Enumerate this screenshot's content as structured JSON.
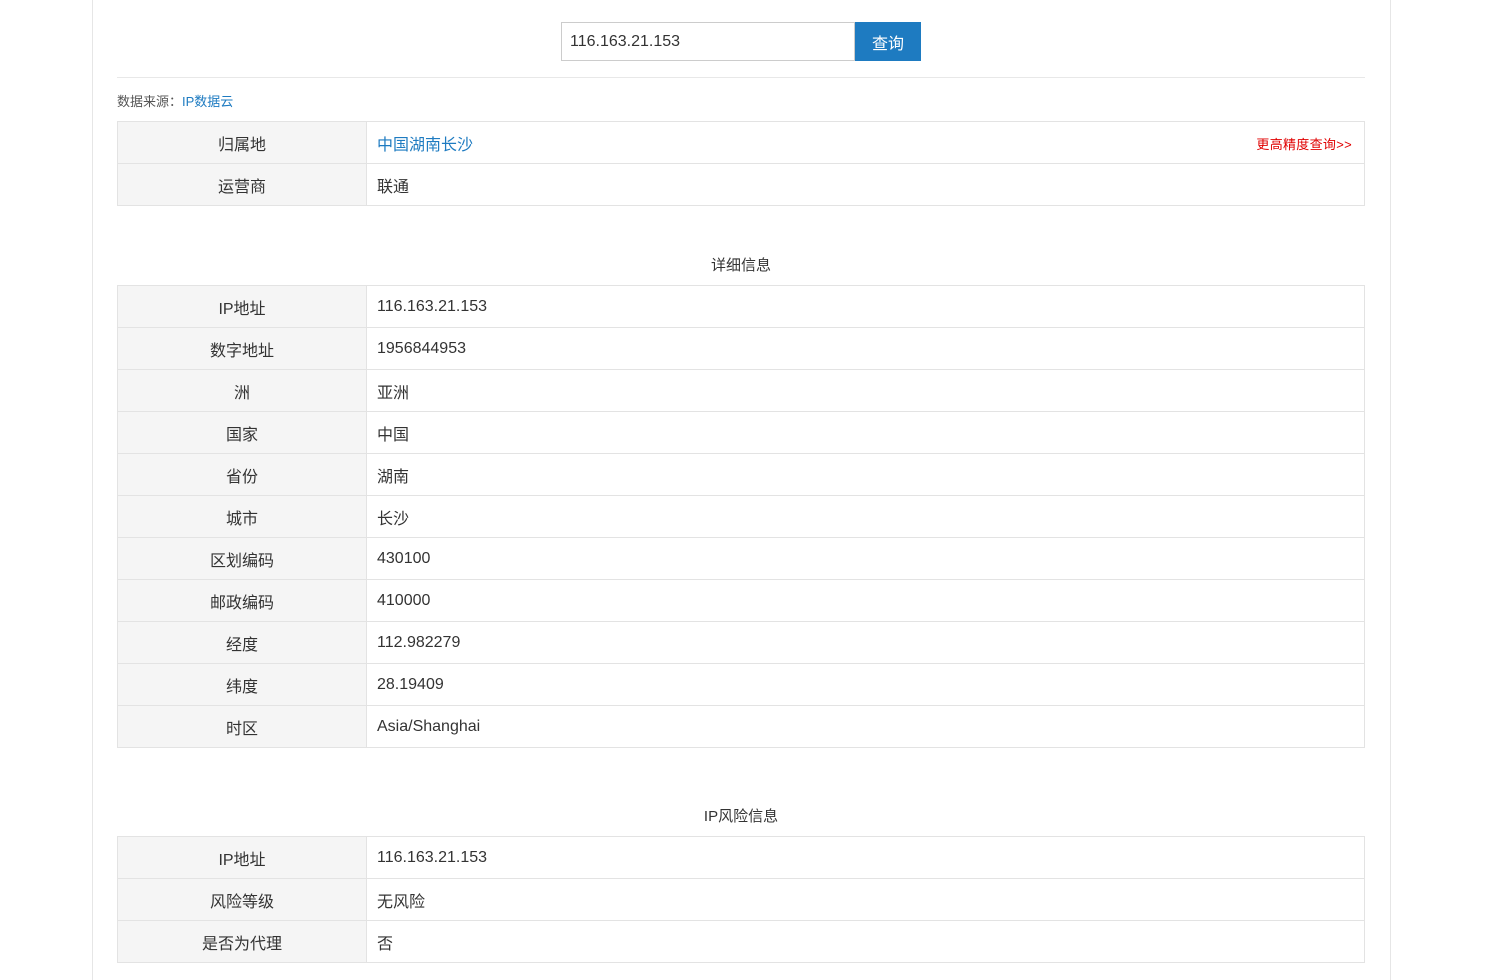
{
  "search": {
    "value": "116.163.21.153",
    "button_label": "查询"
  },
  "source": {
    "prefix": "数据来源：",
    "link": "IP数据云"
  },
  "summary": {
    "rows": [
      {
        "label": "归属地",
        "value": "中国湖南长沙",
        "action": "更高精度查询>>"
      },
      {
        "label": "运营商",
        "value": "联通"
      }
    ]
  },
  "details": {
    "title": "详细信息",
    "rows": [
      {
        "label": "IP地址",
        "value": "116.163.21.153"
      },
      {
        "label": "数字地址",
        "value": "1956844953"
      },
      {
        "label": "洲",
        "value": "亚洲"
      },
      {
        "label": "国家",
        "value": "中国"
      },
      {
        "label": "省份",
        "value": "湖南"
      },
      {
        "label": "城市",
        "value": "长沙"
      },
      {
        "label": "区划编码",
        "value": "430100"
      },
      {
        "label": "邮政编码",
        "value": "410000"
      },
      {
        "label": "经度",
        "value": "112.982279"
      },
      {
        "label": "纬度",
        "value": "28.19409"
      },
      {
        "label": "时区",
        "value": "Asia/Shanghai"
      }
    ]
  },
  "risk": {
    "title": "IP风险信息",
    "rows": [
      {
        "label": "IP地址",
        "value": "116.163.21.153"
      },
      {
        "label": "风险等级",
        "value": "无风险"
      },
      {
        "label": "是否为代理",
        "value": "否"
      }
    ]
  },
  "colors": {
    "accent": "#1e7bc1",
    "alert": "#e00000",
    "label_bg": "#f5f5f5"
  }
}
